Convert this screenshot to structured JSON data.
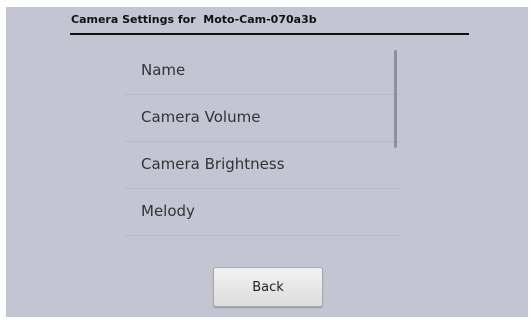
{
  "header": {
    "title": "Camera Settings for  Moto-Cam-070a3b"
  },
  "settings": {
    "items": [
      {
        "label": "Name"
      },
      {
        "label": "Camera Volume"
      },
      {
        "label": "Camera Brightness"
      },
      {
        "label": "Melody"
      }
    ]
  },
  "footer": {
    "back_label": "Back"
  },
  "colors": {
    "background": "#c3c6d2",
    "title_text": "#111111",
    "item_text": "#333333"
  }
}
